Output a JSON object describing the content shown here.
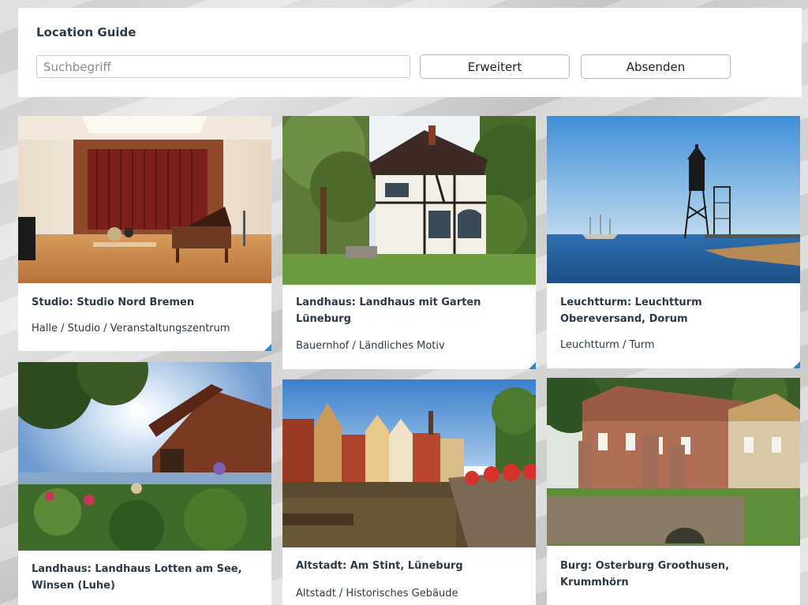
{
  "header": {
    "title": "Location Guide",
    "search_placeholder": "Suchbegriff",
    "advanced_label": "Erweitert",
    "submit_label": "Absenden"
  },
  "cards": [
    {
      "title": "Studio: Studio Nord Bremen",
      "category": "Halle / Studio / Veranstaltungszentrum"
    },
    {
      "title": "Landhaus: Landhaus mit Garten Lüneburg",
      "category": "Bauernhof / Ländliches Motiv"
    },
    {
      "title": "Leuchtturm: Leuchtturm Obereversand, Dorum",
      "category": "Leuchtturm / Turm"
    },
    {
      "title": "Landhaus: Landhaus Lotten am See, Winsen (Luhe)",
      "category": ""
    },
    {
      "title": "Altstadt: Am Stint, Lüneburg",
      "category": "Altstadt / Historisches Gebäude"
    },
    {
      "title": "Burg: Osterburg Groothusen, Krummhörn",
      "category": ""
    }
  ],
  "colors": {
    "corner_accent": "#2f86c9",
    "title_text": "#2c3a48"
  }
}
